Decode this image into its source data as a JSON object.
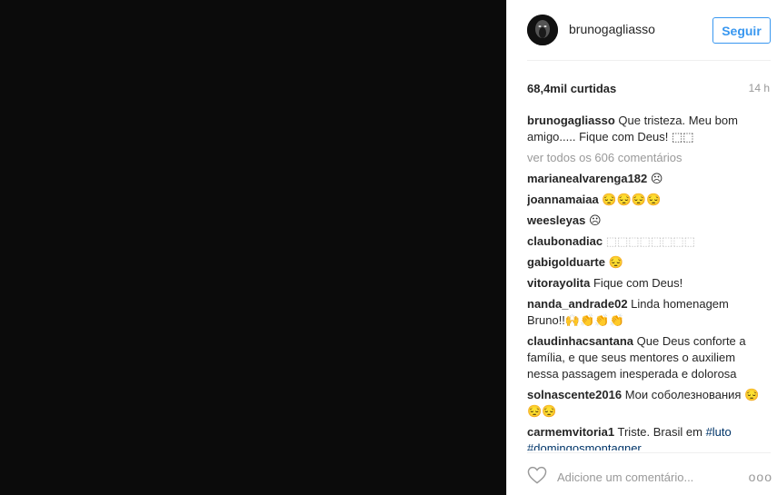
{
  "post": {
    "username": "brunogagliasso",
    "follow_label": "Seguir",
    "likes": "68,4mil curtidas",
    "time": "14 h",
    "caption": {
      "user": "brunogagliasso",
      "text": "Que tristeza. Meu bom amigo..... Fique com Deus! ⬚⬚"
    },
    "view_all": "ver todos os 606 comentários",
    "comments": [
      {
        "user": "marianealvarenga182",
        "text": "☹"
      },
      {
        "user": "joannamaiaa",
        "text": "😔😔😔😔"
      },
      {
        "user": "weesleyas",
        "text": "☹"
      },
      {
        "user": "claubonadiac",
        "text": "⬚⬚⬚⬚⬚⬚⬚⬚"
      },
      {
        "user": "gabigolduarte",
        "text": "😔"
      },
      {
        "user": "vitorayolita",
        "text": "Fique com Deus!"
      },
      {
        "user": "nanda_andrade02",
        "text": "Linda homenagem Bruno!!🙌👏👏👏"
      },
      {
        "user": "claudinhacsantana",
        "text": "Que Deus conforte a família, e que seus mentores o auxiliem nessa passagem inesperada e dolorosa"
      },
      {
        "user": "solnascente2016",
        "text": "Мои соболезнования 😔😔😔"
      },
      {
        "user": "carmemvitoria1",
        "text": "Triste. Brasil em",
        "hashtags": [
          "#luto",
          "#domingosmontagner"
        ]
      }
    ],
    "add_comment_placeholder": "Adicione um comentário...",
    "more_label": "ooo"
  }
}
